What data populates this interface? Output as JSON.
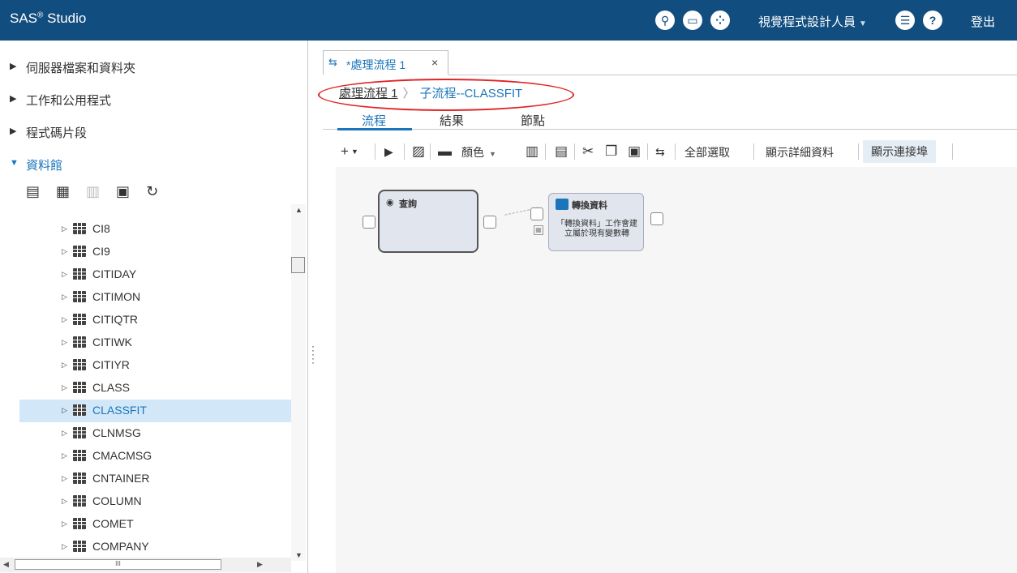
{
  "app": {
    "title": "SAS",
    "title_suffix": " Studio",
    "reg": "®"
  },
  "topbar": {
    "perspective": "視覺程式設計人員",
    "logout": "登出"
  },
  "left": {
    "sections": [
      {
        "label": "伺服器檔案和資料夾"
      },
      {
        "label": "工作和公用程式"
      },
      {
        "label": "程式碼片段"
      },
      {
        "label": "資料館"
      }
    ],
    "tables": [
      "CI8",
      "CI9",
      "CITIDAY",
      "CITIMON",
      "CITIQTR",
      "CITIWK",
      "CITIYR",
      "CLASS",
      "CLASSFIT",
      "CLNMSG",
      "CMACMSG",
      "CNTAINER",
      "COLUMN",
      "COMET",
      "COMPANY"
    ],
    "selected": "CLASSFIT",
    "scroll_thumb_label": "III"
  },
  "tab": {
    "label": "*處理流程 1",
    "close": "×"
  },
  "breadcrumb": {
    "first": "處理流程 1",
    "sep": "〉",
    "second": "子流程--CLASSFIT"
  },
  "subtabs": [
    "流程",
    "結果",
    "節點"
  ],
  "toolbar": {
    "color": "顏色",
    "select_all": "全部選取",
    "show_details": "顯示詳細資料",
    "show_ports": "顯示連接埠"
  },
  "canvas": {
    "node1_title": "查詢",
    "node2_title": "轉換資料",
    "node2_desc": "「轉換資料」工作會建立屬於現有變數轉"
  },
  "colors": {
    "topbar": "#114d7f",
    "accent": "#1b75bb",
    "selected_row": "#d2e8f9",
    "annotation": "#e02424"
  }
}
